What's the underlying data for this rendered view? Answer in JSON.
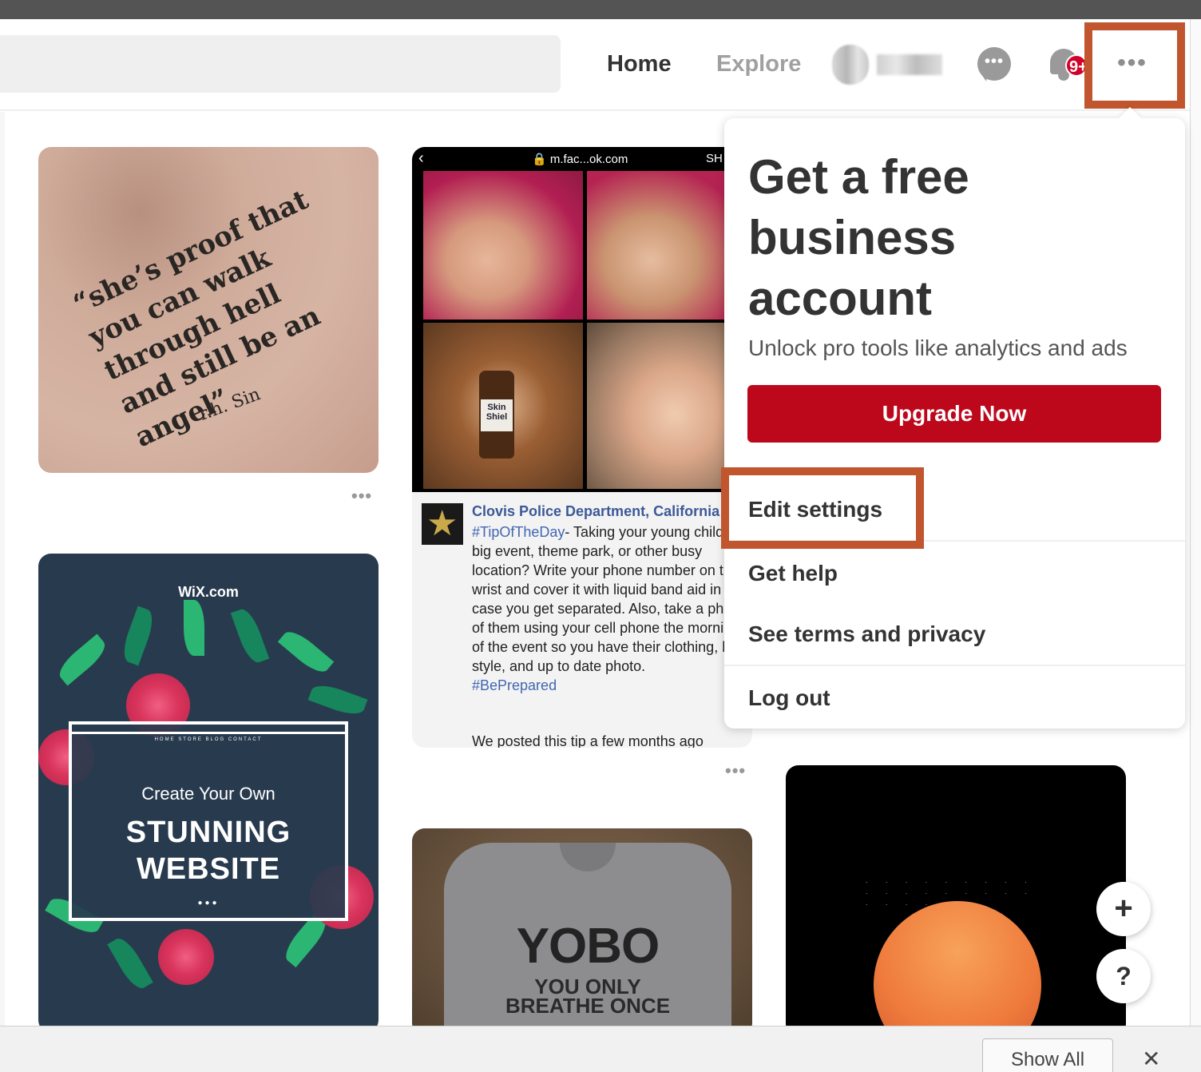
{
  "header": {
    "search_placeholder": "",
    "nav_home": "Home",
    "nav_explore": "Explore",
    "notification_count": "9+",
    "more_icon": "more-horizontal-icon",
    "message_icon": "speech-bubble-icon",
    "bell_icon": "bell-icon"
  },
  "feed": {
    "pin_tattoo": {
      "quote": "“she’s proof that you can walk through hell and still be an angel”",
      "signature": "r.h. Sin"
    },
    "pin_facebook": {
      "url": "m.fac...ok.com",
      "share": "SH",
      "bottle_label": "Skin Shiel",
      "author": "Clovis Police Department, California",
      "hashtag1": "#TipOfTheDay",
      "body": "- Taking your young child to a big event, theme park, or other busy location? Write your phone number on their wrist and cover it with liquid band aid in case you get separated. Also, take a photo of them using your cell phone the morning of the event so you have their clothing, hair style, and up to date photo.",
      "hashtag2": "#BePrepared",
      "footer": "We posted this tip a few months ago"
    },
    "pin_wix": {
      "logo": "WiX.com",
      "menu": "HOME   STORE   BLOG   CONTACT",
      "line1": "Create Your Own",
      "line2": "STUNNING",
      "line3": "WEBSITE"
    },
    "pin_shirt": {
      "big": "YOBO",
      "line1": "YOU ONLY",
      "line2": "BREATHE ONCE"
    }
  },
  "dropdown": {
    "promo_title": "Get a free business account",
    "promo_subtitle": "Unlock pro tools like analytics and ads",
    "upgrade_label": "Upgrade Now",
    "items": [
      "Edit settings",
      "Get help",
      "See terms and privacy",
      "Log out"
    ]
  },
  "fabs": {
    "plus": "+",
    "help": "?"
  },
  "bottom_bar": {
    "show_all": "Show All",
    "close": "✕"
  },
  "colors": {
    "brand_red": "#bd081c",
    "highlight": "#c1552e",
    "badge_red": "#d3002a"
  }
}
